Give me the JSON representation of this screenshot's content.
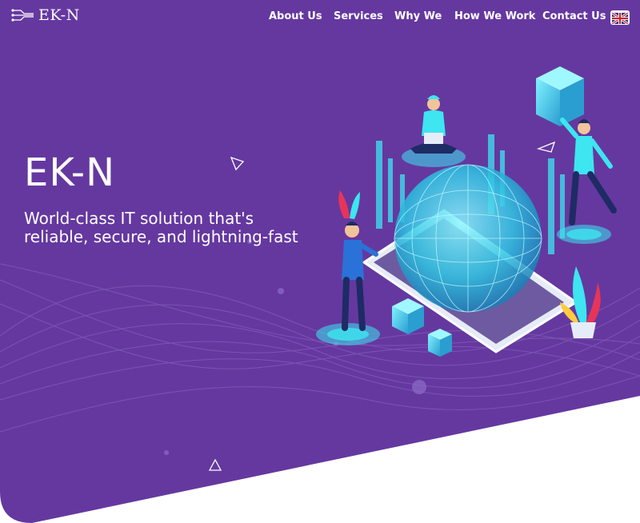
{
  "colors": {
    "hero_background": "#6538a0",
    "accent_cyan": "#3de6f0",
    "accent_red": "#e8345a",
    "text": "#ffffff"
  },
  "header": {
    "logo_text": "EK-N",
    "logo_icon": "circuit-icon",
    "nav_items": [
      {
        "label": "About Us"
      },
      {
        "label": "Services"
      },
      {
        "label": "Why We"
      },
      {
        "label": "How We Work"
      },
      {
        "label": "Contact Us"
      }
    ],
    "language": {
      "icon": "uk-flag-icon"
    }
  },
  "hero": {
    "title": "EK-N",
    "subtitle": "World-class IT solution that's reliable, secure, and lightning-fast"
  }
}
